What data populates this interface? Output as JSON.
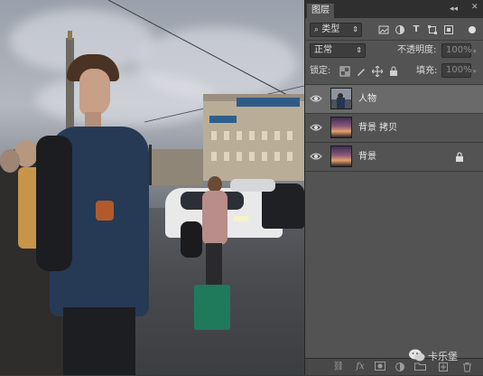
{
  "panel": {
    "tab_label": "图层",
    "tab_collapse": "◂◂",
    "tab_close": "✕",
    "tab_menu": "≡",
    "filter_label": "类型",
    "filter_icons": [
      "image-filter-icon",
      "adjustment-filter-icon",
      "type-filter-icon",
      "shape-filter-icon",
      "smart-object-filter-icon",
      "filter-toggle-icon"
    ],
    "blend_mode": "正常",
    "opacity_label": "不透明度:",
    "opacity_value": "100%",
    "lock_label": "锁定:",
    "fill_label": "填充:",
    "fill_value": "100%",
    "layers": [
      {
        "name": "人物",
        "visible": true,
        "thumb": "person-thumbnail",
        "selected": true,
        "locked": false
      },
      {
        "name": "背景 拷贝",
        "visible": true,
        "thumb": "sunset-thumbnail",
        "selected": false,
        "locked": false
      },
      {
        "name": "背景",
        "visible": true,
        "thumb": "sunset-thumbnail",
        "selected": false,
        "locked": true
      }
    ],
    "bottom_icons": [
      "link-layers-icon",
      "fx-icon",
      "layer-mask-icon",
      "adjustment-layer-icon",
      "new-group-icon",
      "new-layer-icon",
      "delete-layer-icon"
    ]
  },
  "watermark": {
    "text": "卡乐堡"
  }
}
